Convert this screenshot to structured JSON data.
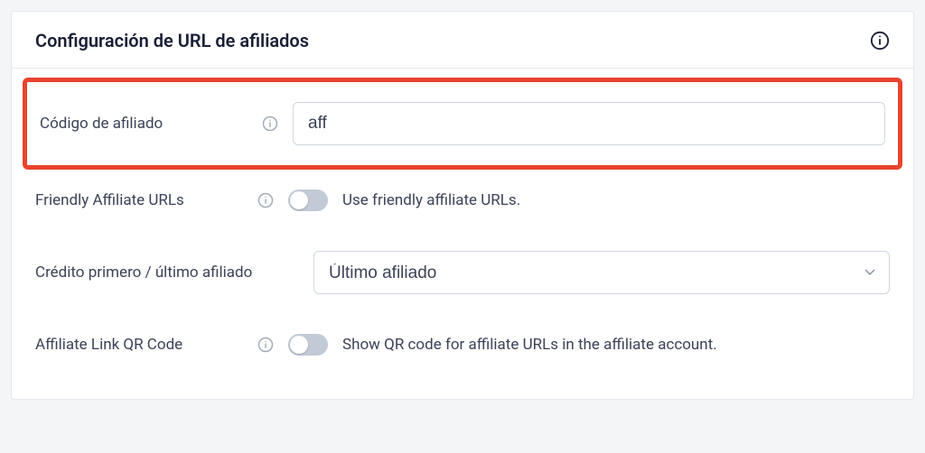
{
  "card": {
    "title": "Configuración de URL de afiliados"
  },
  "fields": {
    "affiliate_code": {
      "label": "Código de afiliado",
      "value": "aff"
    },
    "friendly_urls": {
      "label": "Friendly Affiliate URLs",
      "help": "Use friendly affiliate URLs.",
      "on": false
    },
    "credit": {
      "label": "Crédito primero / último afiliado",
      "selected": "Último afiliado"
    },
    "qr_code": {
      "label": "Affiliate Link QR Code",
      "help": "Show QR code for affiliate URLs in the affiliate account.",
      "on": false
    }
  }
}
